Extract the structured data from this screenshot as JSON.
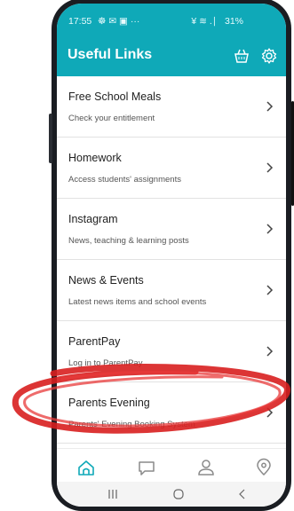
{
  "status_bar": {
    "time": "17:55",
    "notification_icons": "☸ ✉ ▣ ···",
    "right_text": "¥ ≋ .∣",
    "battery": "31%"
  },
  "app_bar": {
    "title": "Useful Links",
    "basket_icon": "basket-icon",
    "settings_icon": "gear-icon"
  },
  "links": [
    {
      "title": "Free School Meals",
      "subtitle": "Check your entitlement"
    },
    {
      "title": "Homework",
      "subtitle": "Access students' assignments"
    },
    {
      "title": "Instagram",
      "subtitle": "News, teaching & learning posts"
    },
    {
      "title": "News & Events",
      "subtitle": "Latest news items and school events"
    },
    {
      "title": "ParentPay",
      "subtitle": "Log in to ParentPay"
    },
    {
      "title": "Parents Evening",
      "subtitle": "Parents' Evening Booking System"
    }
  ],
  "bottom_nav": [
    "home-icon",
    "chat-icon",
    "profile-icon",
    "location-icon"
  ],
  "system_nav": [
    "recents-icon",
    "home-button-icon",
    "back-icon"
  ],
  "colors": {
    "accent": "#0fa9b8",
    "active_nav": "#0fa9b8",
    "inactive_nav": "#8a8a8a",
    "annotation": "#d81f1f"
  }
}
